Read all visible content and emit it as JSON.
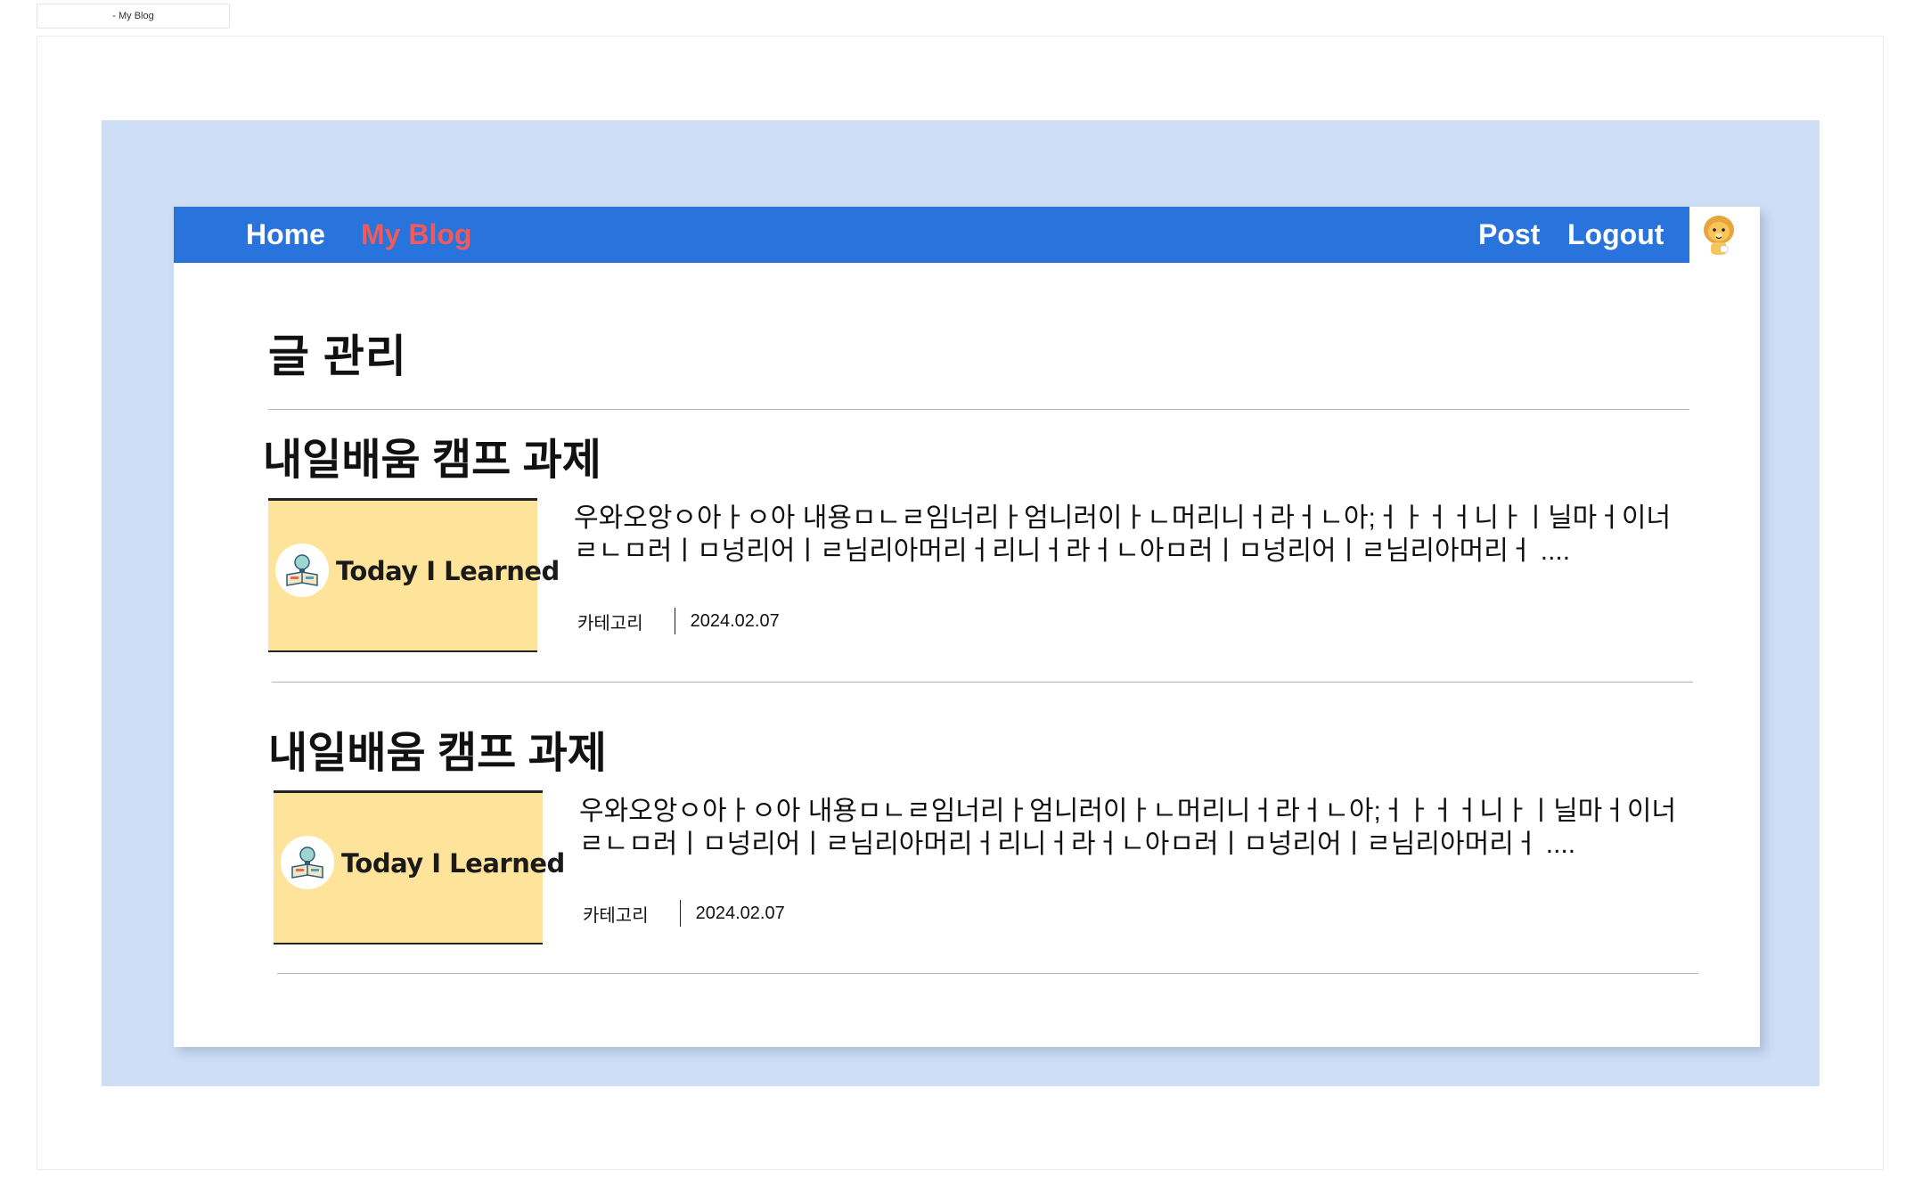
{
  "window": {
    "tab_title": "- My Blog"
  },
  "navbar": {
    "home": "Home",
    "my_blog": "My Blog",
    "post": "Post",
    "logout": "Logout",
    "colors": {
      "bar": "#2874dc",
      "active": "#f15a5a",
      "link": "#ffffff"
    }
  },
  "page": {
    "title": "글 관리"
  },
  "posts": [
    {
      "title": "내일배움 캠프 과제",
      "thumbnail_text": "Today I Learned",
      "excerpt": "우와오앙ㅇ아ㅏㅇ아 내용ㅁㄴㄹ임너리ㅏ엄니러이ㅏㄴ머리니ㅓ라ㅓㄴ아;ㅓㅏㅓㅓ니ㅏㅣ닐마ㅓ이너\nㄹㄴㅁ러ㅣㅁ넝리어ㅣㄹ님리아머리ㅓ리니ㅓ라ㅓㄴ아ㅁ러ㅣㅁ넝리어ㅣㄹ님리아머리ㅓ ....",
      "category": "카테고리",
      "date": "2024.02.07"
    },
    {
      "title": "내일배움 캠프 과제",
      "thumbnail_text": "Today I Learned",
      "excerpt": "우와오앙ㅇ아ㅏㅇ아 내용ㅁㄴㄹ임너리ㅏ엄니러이ㅏㄴ머리니ㅓ라ㅓㄴ아;ㅓㅏㅓㅓ니ㅏㅣ닐마ㅓ이너\nㄹㄴㅁ러ㅣㅁ넝리어ㅣㄹ님리아머리ㅓ리니ㅓ라ㅓㄴ아ㅁ러ㅣㅁ넝리어ㅣㄹ님리아머리ㅓ ....",
      "category": "카테고리",
      "date": "2024.02.07"
    }
  ],
  "icons": {
    "avatar": "lion-character-avatar",
    "thumbnail_logo": "book-lightbulb-icon"
  }
}
